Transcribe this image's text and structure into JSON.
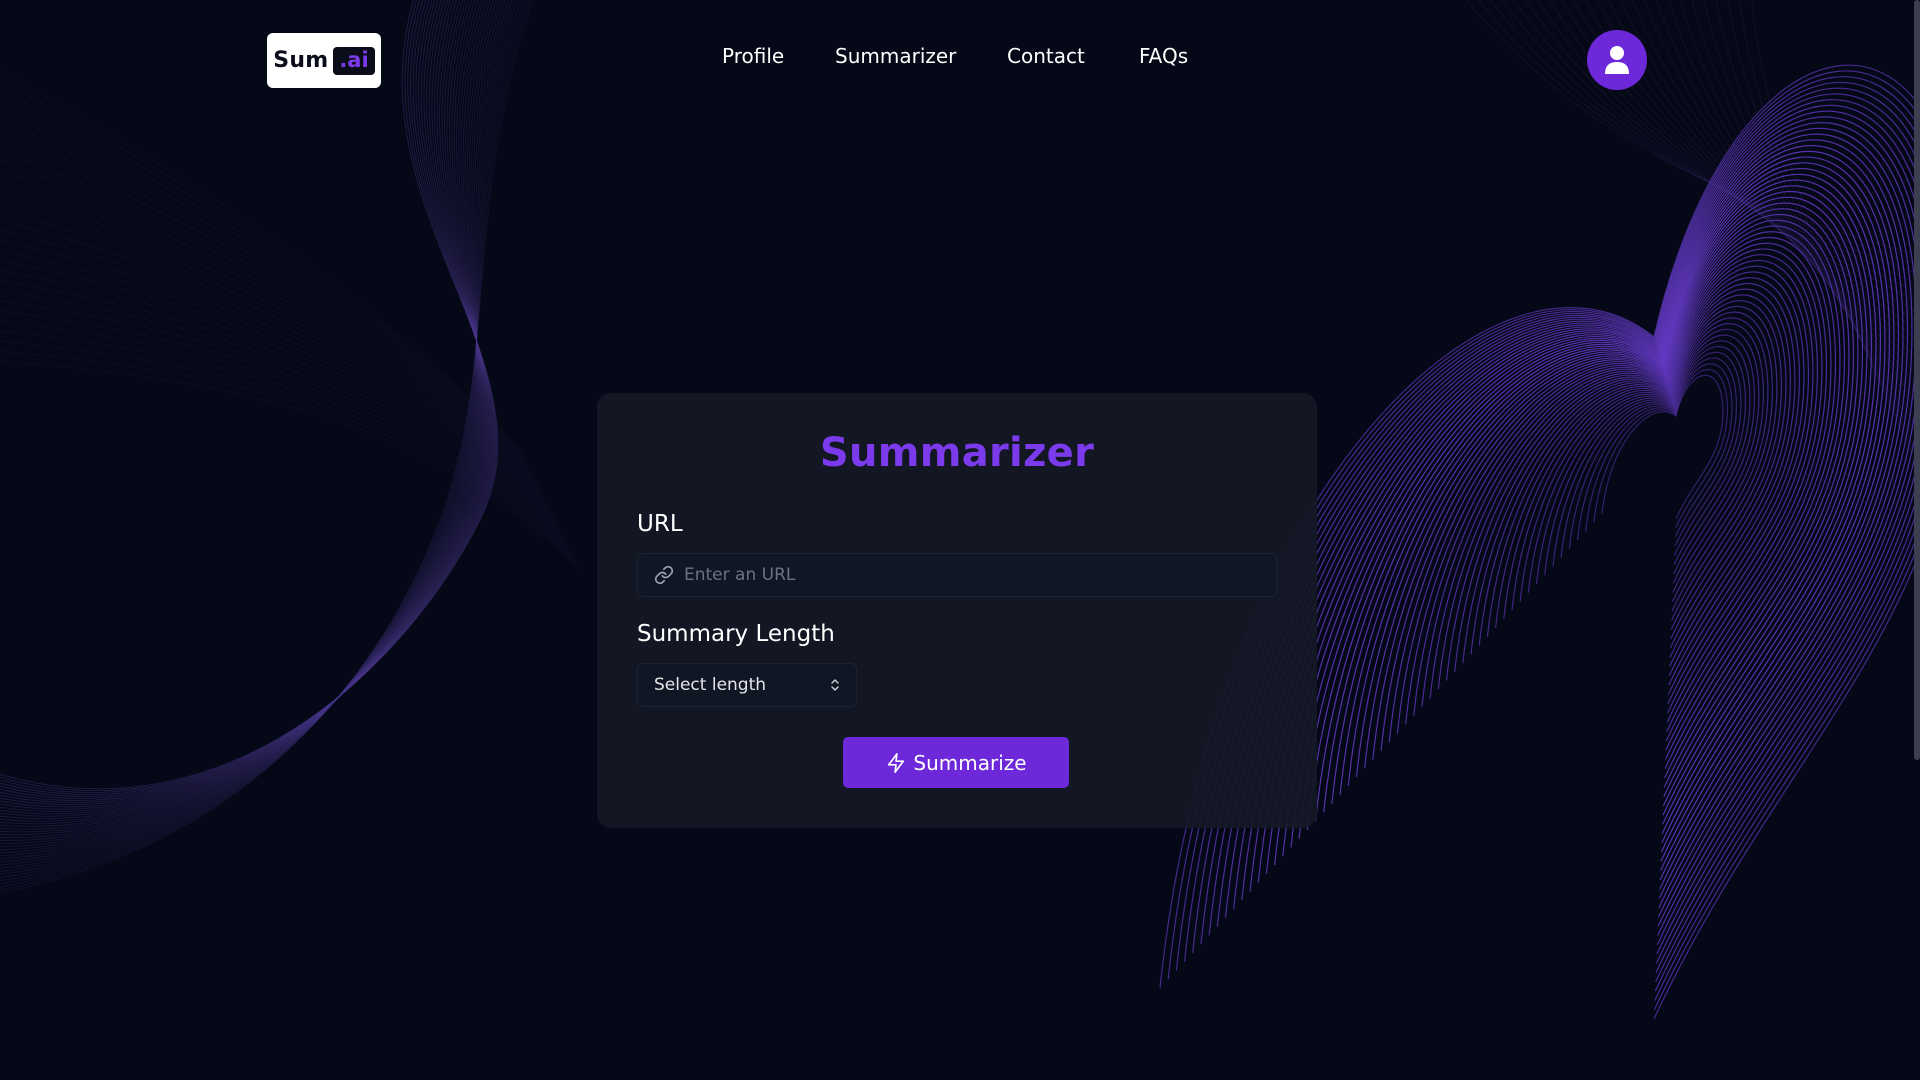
{
  "brand": {
    "name_part1": "Sum",
    "name_part2": ".ai"
  },
  "nav": {
    "items": [
      {
        "label": "Profile"
      },
      {
        "label": "Summarizer"
      },
      {
        "label": "Contact"
      },
      {
        "label": "FAQs"
      }
    ]
  },
  "header": {
    "avatar_icon": "user-icon"
  },
  "card": {
    "title": "Summarizer",
    "url_label": "URL",
    "url_placeholder": "Enter an URL",
    "url_value": "",
    "length_label": "Summary Length",
    "length_selected": "Select length",
    "submit_label": "Summarize"
  },
  "colors": {
    "background": "#050816",
    "accent": "#6d28d9",
    "title": "#7c3aed",
    "card": "#141926"
  }
}
